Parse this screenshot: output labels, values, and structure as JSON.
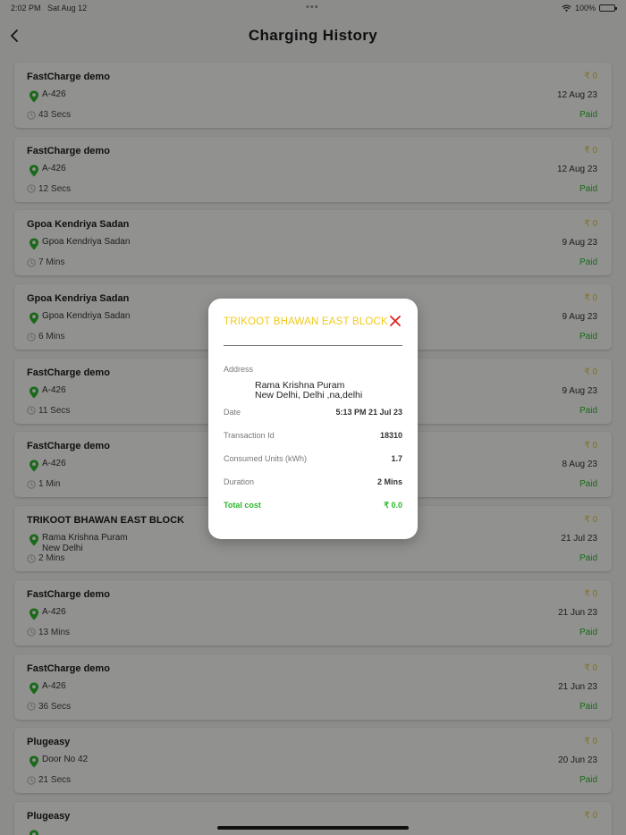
{
  "status_bar": {
    "time": "2:02 PM",
    "date": "Sat Aug 12",
    "dots": "•••",
    "battery": "100%"
  },
  "header": {
    "title": "Charging History"
  },
  "colors": {
    "accent_yellow": "#f2c91c",
    "paid_green": "#2cb82c",
    "pin_green": "#2db52d",
    "close_red": "#e02020"
  },
  "sessions": [
    {
      "name": "FastCharge demo",
      "location": "A-426",
      "duration": "43 Secs",
      "price": "₹ 0",
      "date": "12 Aug 23",
      "status": "Paid"
    },
    {
      "name": "FastCharge demo",
      "location": "A-426",
      "duration": "12 Secs",
      "price": "₹ 0",
      "date": "12 Aug 23",
      "status": "Paid"
    },
    {
      "name": "Gpoa Kendriya Sadan",
      "location": "Gpoa Kendriya Sadan",
      "duration": "7 Mins",
      "price": "₹ 0",
      "date": "9 Aug 23",
      "status": "Paid"
    },
    {
      "name": "Gpoa Kendriya Sadan",
      "location": "Gpoa Kendriya Sadan",
      "duration": "6 Mins",
      "price": "₹ 0",
      "date": "9 Aug 23",
      "status": "Paid"
    },
    {
      "name": "FastCharge demo",
      "location": "A-426",
      "duration": "11 Secs",
      "price": "₹ 0",
      "date": "9 Aug 23",
      "status": "Paid"
    },
    {
      "name": "FastCharge demo",
      "location": "A-426",
      "duration": "1 Min",
      "price": "₹ 0",
      "date": "8 Aug 23",
      "status": "Paid"
    },
    {
      "name": "TRIKOOT BHAWAN EAST BLOCK",
      "location": "Rama Krishna Puram\nNew Delhi",
      "duration": "2 Mins",
      "price": "₹ 0",
      "date": "21 Jul 23",
      "status": "Paid"
    },
    {
      "name": "FastCharge demo",
      "location": "A-426",
      "duration": "13 Mins",
      "price": "₹ 0",
      "date": "21 Jun 23",
      "status": "Paid"
    },
    {
      "name": "FastCharge demo",
      "location": "A-426",
      "duration": "36 Secs",
      "price": "₹ 0",
      "date": "21 Jun 23",
      "status": "Paid"
    },
    {
      "name": "Plugeasy",
      "location": "Door No 42",
      "duration": "21 Secs",
      "price": "₹ 0",
      "date": "20 Jun 23",
      "status": "Paid"
    },
    {
      "name": "Plugeasy",
      "location": "",
      "duration": "",
      "price": "₹ 0",
      "date": "",
      "status": ""
    }
  ],
  "modal": {
    "title": "TRIKOOT BHAWAN EAST BLOCK",
    "address_label": "Address",
    "address_line1": "Rama Krishna Puram",
    "address_line2": "New Delhi, Delhi ,na,delhi",
    "date_label": "Date",
    "date_value": "5:13 PM 21 Jul 23",
    "transaction_label": "Transaction Id",
    "transaction_value": "18310",
    "units_label": "Consumed Units (kWh)",
    "units_value": "1.7",
    "duration_label": "Duration",
    "duration_value": "2 Mins",
    "total_label": "Total cost",
    "total_value": "₹ 0.0"
  }
}
